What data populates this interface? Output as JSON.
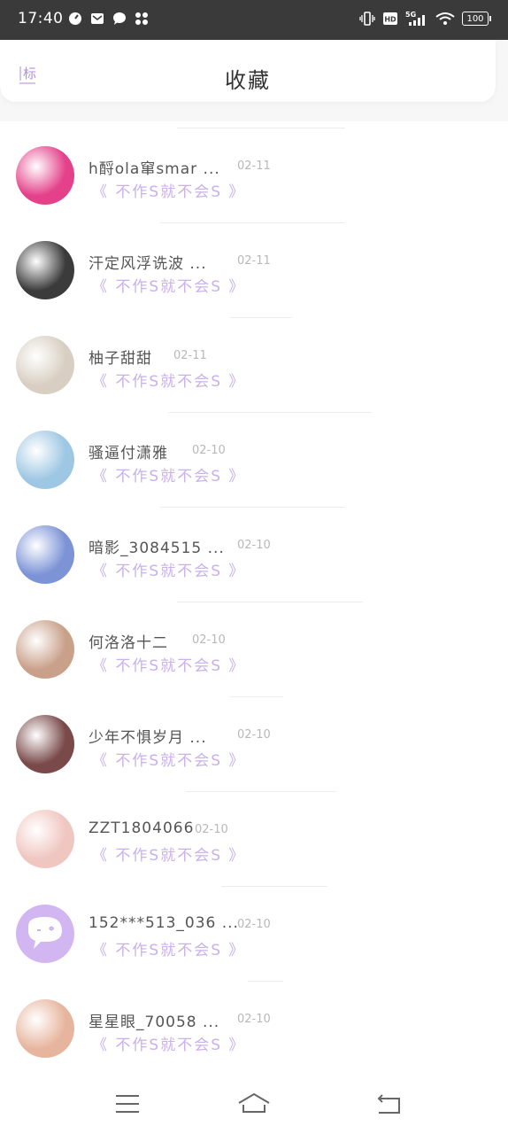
{
  "status_bar": {
    "time": "17:40",
    "left_icons": [
      "timer-icon",
      "mail-icon",
      "chat-bubble-icon",
      "fan-icon"
    ],
    "right_icons": [
      "vibrate-icon",
      "hd-icon",
      "signal-5g-icon",
      "wifi-icon"
    ],
    "network": "5G",
    "battery": "100"
  },
  "header": {
    "left_label": "标",
    "title": "收藏"
  },
  "favorites": [
    {
      "name": "h酹ola窜smar ...",
      "date": "02-11",
      "text": "《 不作S就不会S 》",
      "avatar_color": "#e4418a"
    },
    {
      "name": "汗定风浮诜波 ...",
      "date": "02-11",
      "text": "《 不作S就不会S 》",
      "avatar_color": "#3b3b3b"
    },
    {
      "name": "柚子甜甜",
      "date": "02-11",
      "text": "《 不作S就不会S 》",
      "avatar_color": "#d8cfc2"
    },
    {
      "name": "骚逼付潇雅",
      "date": "02-10",
      "text": "《 不作S就不会S 》",
      "avatar_color": "#9ec7e3"
    },
    {
      "name": "暗影_3084515 ...",
      "date": "02-10",
      "text": "《 不作S就不会S 》",
      "avatar_color": "#7c93d6"
    },
    {
      "name": "何洛洛十二",
      "date": "02-10",
      "text": "《 不作S就不会S 》",
      "avatar_color": "#c9a08a"
    },
    {
      "name": "少年不惧岁月 ...",
      "date": "02-10",
      "text": "《 不作S就不会S 》",
      "avatar_color": "#7a4a4a"
    },
    {
      "name": "ZZT1804066",
      "date": "02-10",
      "text": "《 不作S就不会S 》",
      "avatar_color": "#f0c6c0"
    },
    {
      "name": "152***513_036 ...",
      "date": "02-10",
      "text": "《 不作S就不会S 》",
      "avatar_color": "#d2b6f2"
    },
    {
      "name": "星星眼_70058 ...",
      "date": "02-10",
      "text": "《 不作S就不会S 》",
      "avatar_color": "#e7b59e"
    }
  ],
  "bottom_nav": {
    "icons": [
      "menu-icon",
      "home-icon",
      "back-icon"
    ]
  },
  "colors": {
    "accent": "#c9b0ec",
    "status_bar": "#3a3a3a"
  }
}
